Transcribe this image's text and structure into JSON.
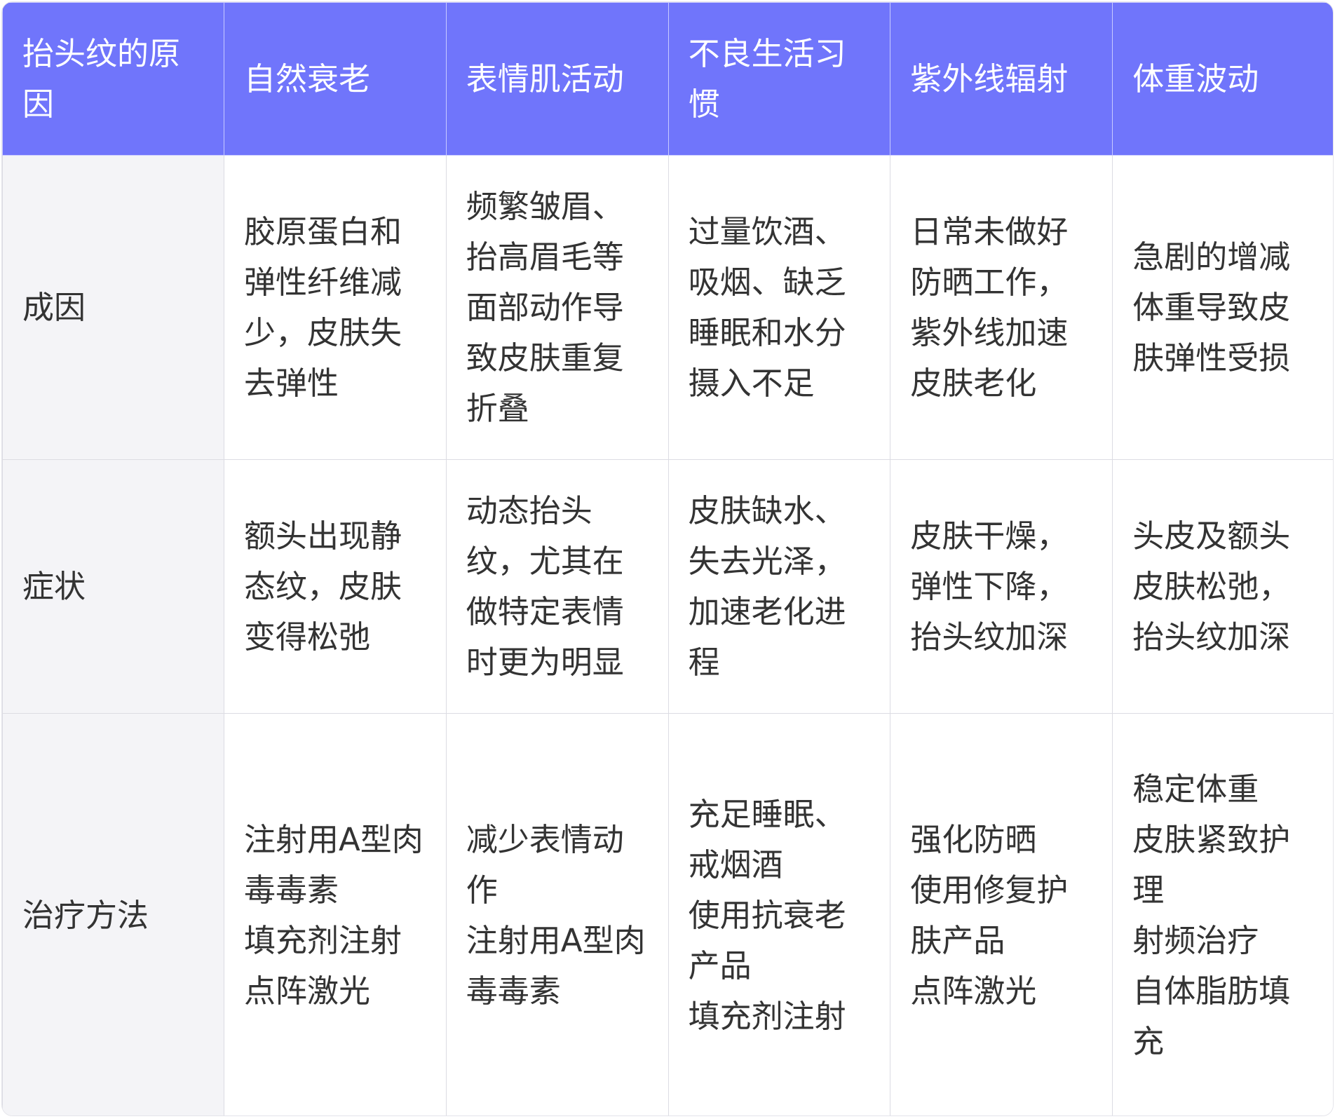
{
  "table": {
    "headers": [
      "抬头纹的原因",
      "自然衰老",
      "表情肌活动",
      "不良生活习惯",
      "紫外线辐射",
      "体重波动"
    ],
    "rows": [
      {
        "label": "成因",
        "cells": [
          [
            "胶原蛋白和弹性纤维减少，皮肤失去弹性"
          ],
          [
            "频繁皱眉、抬高眉毛等面部动作导致皮肤重复折叠"
          ],
          [
            "过量饮酒、吸烟、缺乏睡眠和水分摄入不足"
          ],
          [
            "日常未做好防晒工作，紫外线加速皮肤老化"
          ],
          [
            "急剧的增减体重导致皮肤弹性受损"
          ]
        ]
      },
      {
        "label": "症状",
        "cells": [
          [
            "额头出现静态纹，皮肤变得松弛"
          ],
          [
            "动态抬头纹，尤其在做特定表情时更为明显"
          ],
          [
            "皮肤缺水、失去光泽，加速老化进程"
          ],
          [
            "皮肤干燥，弹性下降，抬头纹加深"
          ],
          [
            "头皮及额头皮肤松弛，抬头纹加深"
          ]
        ]
      },
      {
        "label": "治疗方法",
        "cells": [
          [
            "注射用A型肉毒毒素",
            "填充剂注射",
            "点阵激光"
          ],
          [
            "减少表情动作",
            "注射用A型肉毒毒素"
          ],
          [
            "充足睡眠、戒烟酒",
            "使用抗衰老产品",
            "填充剂注射"
          ],
          [
            "强化防晒",
            "使用修复护肤产品",
            "点阵激光"
          ],
          [
            "稳定体重",
            "皮肤紧致护理",
            "射频治疗",
            "自体脂肪填充"
          ]
        ]
      }
    ]
  }
}
